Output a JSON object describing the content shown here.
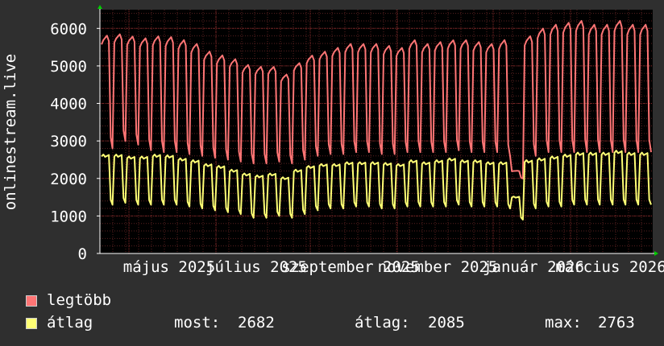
{
  "chart_data": {
    "type": "line",
    "ylabel": "onlinestream.live",
    "ylim": [
      0,
      6500
    ],
    "yticks": [
      0,
      1000,
      2000,
      3000,
      4000,
      5000,
      6000
    ],
    "x_tick_labels": [
      "május 2025",
      "július 2025",
      "szeptember 2025",
      "november 2025",
      "január 2026",
      "március 2026"
    ],
    "grid": true,
    "series": [
      {
        "name": "legtöbb",
        "color": "#ff7575",
        "weekly_high": [
          5720,
          5760,
          5700,
          5650,
          5700,
          5680,
          5600,
          5500,
          5300,
          5200,
          5100,
          4950,
          4900,
          4900,
          4700,
          5000,
          5200,
          5300,
          5400,
          5500,
          5500,
          5500,
          5450,
          5400,
          5600,
          5500,
          5550,
          5600,
          5600,
          5550,
          5500,
          5600,
          2200,
          5700,
          5900,
          6000,
          6050,
          6100,
          6000,
          6000,
          6100,
          6000,
          6000
        ],
        "weekly_low": [
          2800,
          3000,
          2900,
          2750,
          2700,
          2700,
          2650,
          2600,
          2550,
          2500,
          2450,
          2400,
          2400,
          2450,
          2400,
          2500,
          2600,
          2650,
          2650,
          2700,
          2700,
          2650,
          2650,
          2700,
          2700,
          2700,
          2700,
          2750,
          2700,
          2700,
          2700,
          2600,
          2000,
          2600,
          2700,
          2700,
          2700,
          2700,
          2700,
          2700,
          2700,
          2700,
          2700
        ]
      },
      {
        "name": "átlag",
        "color": "#ffff75",
        "weekly_high": [
          2600,
          2600,
          2550,
          2550,
          2600,
          2580,
          2500,
          2450,
          2350,
          2300,
          2200,
          2100,
          2050,
          2100,
          2000,
          2200,
          2300,
          2350,
          2350,
          2400,
          2400,
          2400,
          2380,
          2350,
          2450,
          2400,
          2450,
          2500,
          2450,
          2450,
          2400,
          2400,
          1500,
          2450,
          2500,
          2550,
          2600,
          2650,
          2650,
          2650,
          2700,
          2650,
          2650
        ],
        "weekly_low": [
          1300,
          1350,
          1300,
          1300,
          1300,
          1300,
          1250,
          1200,
          1150,
          1100,
          1050,
          950,
          950,
          1000,
          950,
          1050,
          1150,
          1200,
          1200,
          1250,
          1250,
          1200,
          1200,
          1250,
          1250,
          1250,
          1250,
          1300,
          1250,
          1250,
          1250,
          1200,
          900,
          1200,
          1250,
          1250,
          1300,
          1300,
          1300,
          1300,
          1300,
          1300,
          1300
        ]
      }
    ]
  },
  "legend": {
    "items": [
      {
        "label": "legtöbb",
        "color": "#ff7575"
      },
      {
        "label": "átlag",
        "color": "#ffff75"
      }
    ],
    "stats": {
      "now_label": "most:",
      "now_value": "2682",
      "avg_label": "átlag:",
      "avg_value": "2085",
      "max_label": "max:",
      "max_value": "2763"
    }
  },
  "colors": {
    "background": "#2f2f2f",
    "plot_background": "#000000",
    "minor_grid": "#5a2020",
    "major_grid": "#8a2a2a",
    "axis": "#ffffff",
    "arrow": "#00cc00"
  }
}
